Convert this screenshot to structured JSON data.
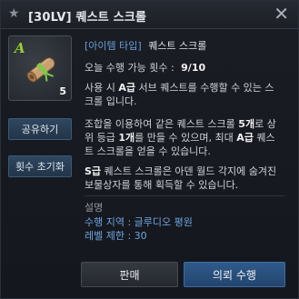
{
  "window": {
    "title": "[30LV] 퀘스트 스크롤",
    "title_icon": "star-icon",
    "close_icon": "close-icon"
  },
  "item": {
    "grade": "A",
    "quantity": "5",
    "icon": "scroll-icon",
    "grade_color": "#9acd32"
  },
  "side_buttons": {
    "share": "공유하기",
    "reset_count": "횟수 초기화"
  },
  "details": {
    "type_tag": "[아이템 타입]",
    "type_value": "퀘스트 스크롤",
    "daily_label": "오늘 수행 가능 횟수 :",
    "daily_value": "9/10",
    "desc1": {
      "a": "사용 시 ",
      "b": "A급",
      "c": " 서브 퀘스트를 수행할 수 있는 스크롤 입니다."
    },
    "desc2": {
      "a": "조합을 이용하여 같은 퀘스트 스크롤 ",
      "b": "5개",
      "c": "로 상위 등급 ",
      "d": "1개",
      "e": "를 만들 수 있으며, 최대 ",
      "f": "A급",
      "g": " 퀘스트 스크롤을 얻을 수 있습니다."
    },
    "desc3": {
      "a": "S급",
      "b": " 퀘스트 스크롤은 아덴 월드 각지에 숨겨진 보물상자를 통해 획득할 수 있습니다."
    }
  },
  "explanation": {
    "header": "설명",
    "region": "수행 지역 : 글루디오 평원",
    "level": "레벨 제한 : 30"
  },
  "actions": {
    "sell": "판매",
    "quest": "의뢰 수행"
  },
  "colors": {
    "accent_blue": "#6a9fd8",
    "button_blue": "#2f5a8a"
  }
}
